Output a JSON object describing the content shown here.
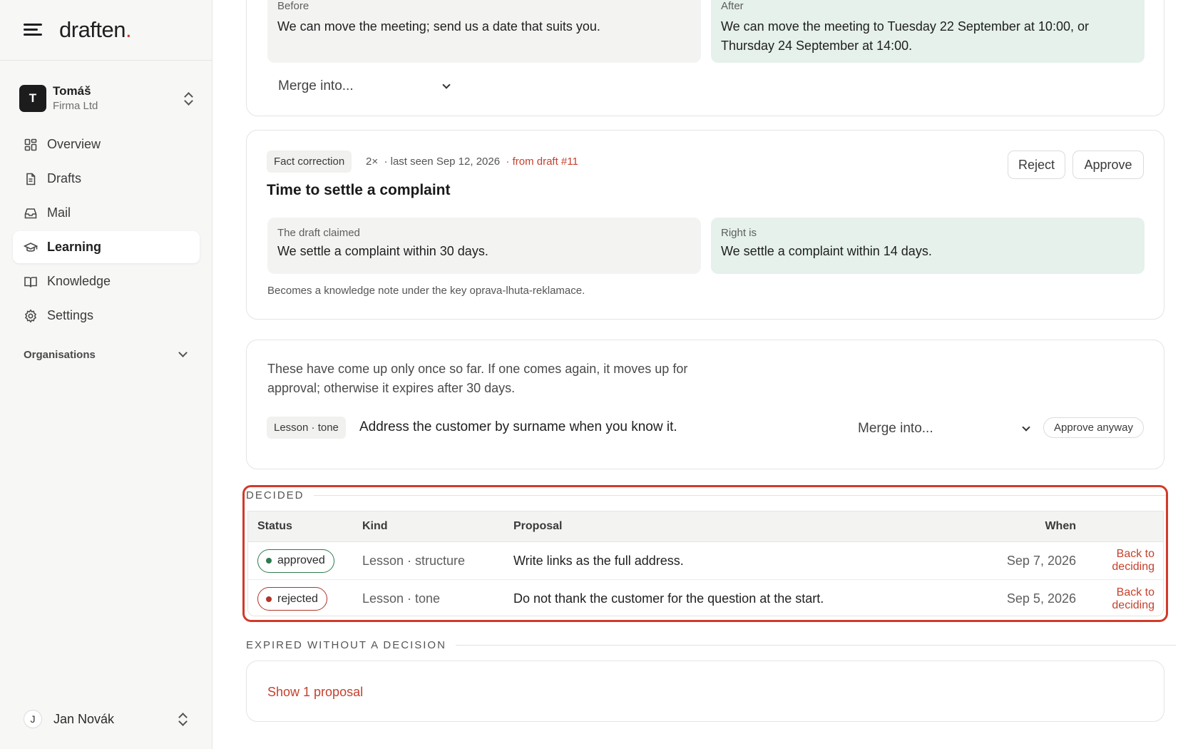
{
  "brand": {
    "name": "draften",
    "dot": "."
  },
  "workspace": {
    "initial": "T",
    "name": "Tomáš",
    "org": "Firma Ltd"
  },
  "nav": {
    "items": [
      {
        "label": "Overview",
        "icon": "grid-icon"
      },
      {
        "label": "Drafts",
        "icon": "document-icon"
      },
      {
        "label": "Mail",
        "icon": "inbox-icon"
      },
      {
        "label": "Learning",
        "icon": "graduation-cap-icon",
        "active": true
      },
      {
        "label": "Knowledge",
        "icon": "book-icon"
      },
      {
        "label": "Settings",
        "icon": "gear-icon"
      }
    ],
    "organisations_label": "Organisations"
  },
  "user": {
    "initial": "J",
    "name": "Jan Novák"
  },
  "card1": {
    "before_label": "Before",
    "before_text": "We can move the meeting; send us a date that suits you.",
    "after_label": "After",
    "after_text": "We can move the meeting to Tuesday 22 September at 10:00, or Thursday 24 September at 14:00.",
    "merge_label": "Merge into..."
  },
  "card2": {
    "tag": "Fact correction",
    "count": "2×",
    "last_seen": "· last seen Sep 12, 2026",
    "from_draft": "· from draft #11",
    "reject_label": "Reject",
    "approve_label": "Approve",
    "title": "Time to settle a complaint",
    "claimed_label": "The draft claimed",
    "claimed_text": "We settle a complaint within 30 days.",
    "right_label": "Right is",
    "right_text": "We settle a complaint within 14 days.",
    "note": "Becomes a knowledge note under the key oprava-lhuta-reklamace."
  },
  "card3": {
    "intro": "These have come up only once so far. If one comes again, it moves up for approval; otherwise it expires after 30 days.",
    "tag": "Lesson · tone",
    "text": "Address the customer by surname when you know it.",
    "merge_label": "Merge into...",
    "approve_anyway_label": "Approve anyway"
  },
  "decided": {
    "heading": "DECIDED",
    "columns": {
      "status": "Status",
      "kind": "Kind",
      "proposal": "Proposal",
      "when": "When"
    },
    "rows": [
      {
        "status": "approved",
        "kind": "Lesson · structure",
        "proposal": "Write links as the full address.",
        "when": "Sep 7, 2026",
        "action": "Back to deciding"
      },
      {
        "status": "rejected",
        "kind": "Lesson · tone",
        "proposal": "Do not thank the customer for the question at the start.",
        "when": "Sep 5, 2026",
        "action": "Back to deciding"
      }
    ]
  },
  "expired": {
    "heading": "EXPIRED WITHOUT A DECISION",
    "show_label": "Show 1 proposal"
  },
  "colors": {
    "accent": "#c6402d",
    "approved": "#2f7a4f",
    "rejected": "#b23327",
    "highlight_border": "#d23a2a",
    "green_box": "#e5f1ea",
    "grey_box": "#f3f3f2"
  }
}
